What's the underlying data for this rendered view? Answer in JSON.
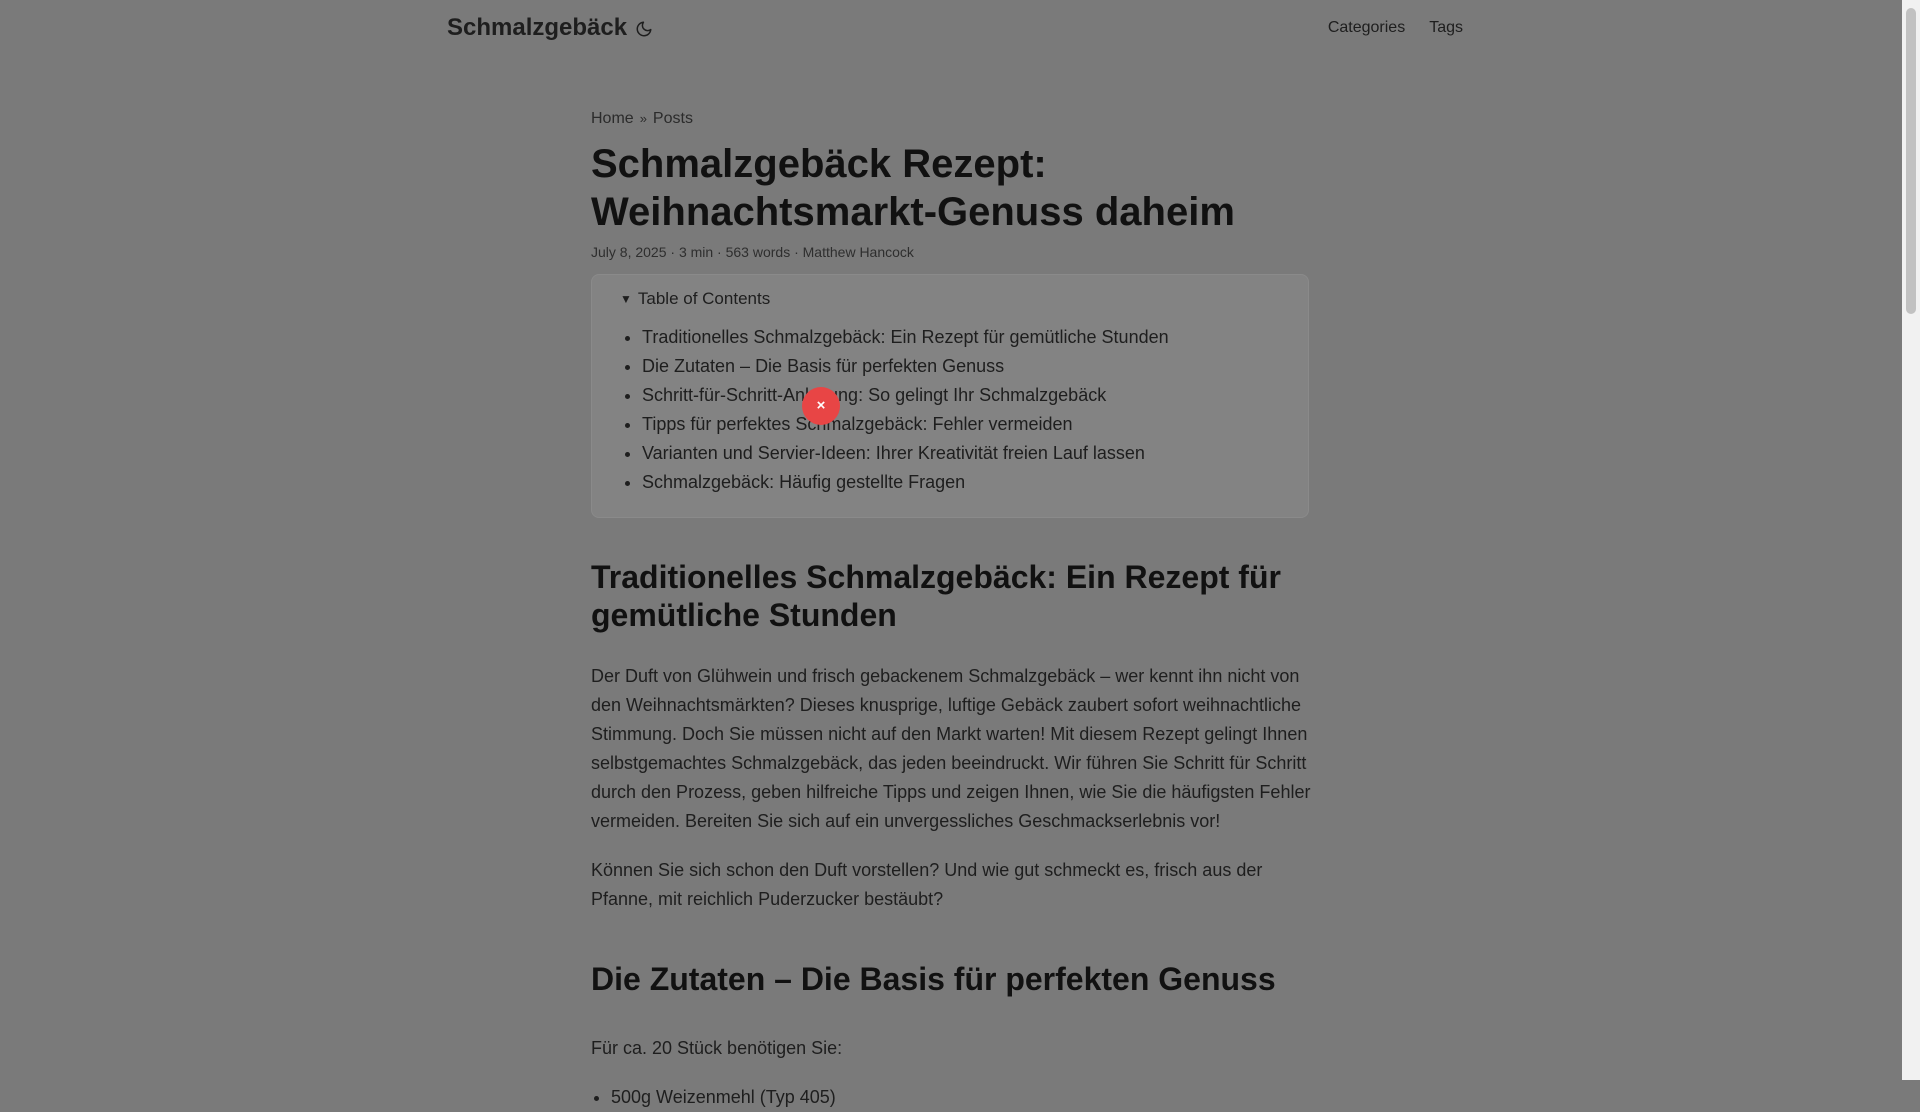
{
  "header": {
    "logo": "Schmalzgebäck",
    "nav": [
      "Categories",
      "Tags"
    ]
  },
  "breadcrumbs": [
    "Home",
    "Posts"
  ],
  "breadcrumb_separator": "»",
  "post": {
    "title": "Schmalzgebäck Rezept: Weihnachtsmarkt-Genuss daheim",
    "meta": "July 8, 2025 · 3 min · 563 words · Matthew Hancock"
  },
  "toc": {
    "summary": "Table of Contents",
    "items": [
      "Traditionelles Schmalzgebäck: Ein Rezept für gemütliche Stunden",
      "Die Zutaten – Die Basis für perfekten Genuss",
      "Schritt-für-Schritt-Anleitung: So gelingt Ihr Schmalzgebäck",
      "Tipps für perfektes Schmalzgebäck: Fehler vermeiden",
      "Varianten und Servier-Ideen: Ihrer Kreativität freien Lauf lassen",
      "Schmalzgebäck: Häufig gestellte Fragen"
    ]
  },
  "close_button": "×",
  "content": {
    "h2_1": "Traditionelles Schmalzgebäck: Ein Rezept für gemütliche Stunden",
    "p1": "Der Duft von Glühwein und frisch gebackenem Schmalzgebäck – wer kennt ihn nicht von den Weihnachtsmärkten? Dieses knusprige, luftige Gebäck zaubert sofort weihnachtliche Stimmung. Doch Sie müssen nicht auf den Markt warten! Mit diesem Rezept gelingt Ihnen selbstgemachtes Schmalzgebäck, das jeden beeindruckt. Wir führen Sie Schritt für Schritt durch den Prozess, geben hilfreiche Tipps und zeigen Ihnen, wie Sie die häufigsten Fehler vermeiden. Bereiten Sie sich auf ein unvergessliches Geschmackserlebnis vor!",
    "p2": "Können Sie sich schon den Duft vorstellen? Und wie gut schmeckt es, frisch aus der Pfanne, mit reichlich Puderzucker bestäubt?",
    "h2_2": "Die Zutaten – Die Basis für perfekten Genuss",
    "p3": "Für ca. 20 Stück benötigen Sie:",
    "ingredients": [
      "500g Weizenmehl (Typ 405)"
    ]
  },
  "colors": {
    "overlay_background": "#7a7a7a",
    "close_button": "#e84545"
  }
}
